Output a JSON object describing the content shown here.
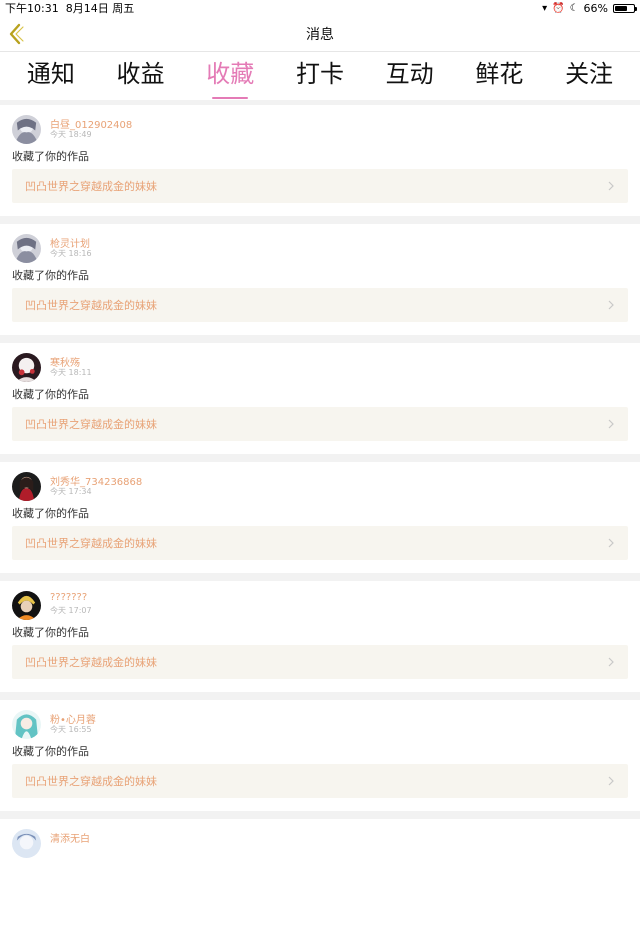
{
  "status": {
    "time": "下午10:31",
    "date": "8月14日 周五",
    "battery": "66%",
    "battery_level": 0.66
  },
  "nav": {
    "title": "消息"
  },
  "tabs": [
    "通知",
    "收益",
    "收藏",
    "打卡",
    "互动",
    "鲜花",
    "关注"
  ],
  "active_tab": 2,
  "colors": {
    "accent": "#e47bb6",
    "name": "#e8a276",
    "work_bg": "#f7f5ef"
  },
  "items": [
    {
      "name": "白昼_012902408",
      "time": "今天 18:49",
      "action": "收藏了你的作品",
      "work": "凹凸世界之穿越成金的妹妹",
      "avatar": "gray-anime"
    },
    {
      "name": "枪灵计划",
      "time": "今天 18:16",
      "action": "收藏了你的作品",
      "work": "凹凸世界之穿越成金的妹妹",
      "avatar": "gray-anime"
    },
    {
      "name": "寒秋殇",
      "time": "今天 18:11",
      "action": "收藏了你的作品",
      "work": "凹凸世界之穿越成金的妹妹",
      "avatar": "red-white"
    },
    {
      "name": "刘秀华_734236868",
      "time": "今天 17:34",
      "action": "收藏了你的作品",
      "work": "凹凸世界之穿越成金的妹妹",
      "avatar": "dark-red"
    },
    {
      "name": "???????",
      "time": "今天 17:07",
      "action": "收藏了你的作品",
      "work": "凹凸世界之穿越成金的妹妹",
      "avatar": "blonde-dark"
    },
    {
      "name": "粉•心月蓉",
      "time": "今天 16:55",
      "action": "收藏了你的作品",
      "work": "凹凸世界之穿越成金的妹妹",
      "avatar": "teal-anime"
    },
    {
      "name": "清添无白",
      "time": "",
      "action": "",
      "work": "",
      "avatar": "blue-anime"
    }
  ]
}
